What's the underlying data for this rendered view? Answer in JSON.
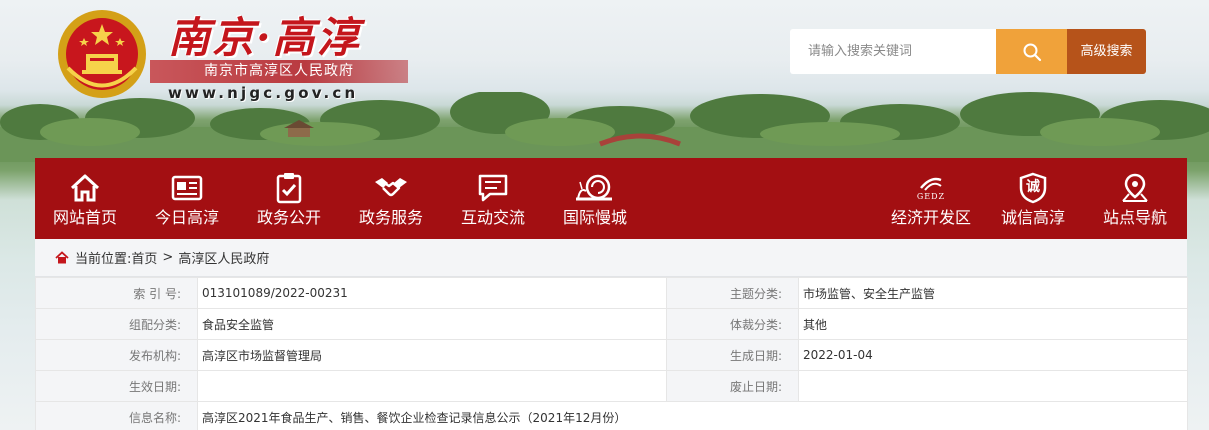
{
  "header": {
    "site_title": "南京·高淳",
    "site_subtitle": "南京市高淳区人民政府",
    "site_url": "www.njgc.gov.cn"
  },
  "search": {
    "placeholder": "请输入搜索关键词",
    "advanced_label": "高级搜索"
  },
  "nav": {
    "items": [
      {
        "label": "网站首页",
        "icon": "home-icon"
      },
      {
        "label": "今日高淳",
        "icon": "newspaper-icon"
      },
      {
        "label": "政务公开",
        "icon": "clipboard-check-icon"
      },
      {
        "label": "政务服务",
        "icon": "handshake-icon"
      },
      {
        "label": "互动交流",
        "icon": "chat-icon"
      },
      {
        "label": "国际慢城",
        "icon": "snail-icon"
      },
      {
        "label": "经济开发区",
        "icon": "gedz-logo-icon",
        "badge": "GEDZ"
      },
      {
        "label": "诚信高淳",
        "icon": "integrity-badge-icon",
        "badge": "诚"
      },
      {
        "label": "站点导航",
        "icon": "location-pin-icon"
      }
    ]
  },
  "breadcrumb": {
    "prefix": "当前位置:",
    "items": [
      "首页",
      "高淳区人民政府"
    ],
    "separator": ">"
  },
  "info_table": {
    "index_label": "索 引 号:",
    "index_value": "013101089/2022-00231",
    "topic_label": "主题分类:",
    "topic_value": "市场监管、安全生产监管",
    "category_label": "组配分类:",
    "category_value": "食品安全监管",
    "genre_label": "体裁分类:",
    "genre_value": "其他",
    "publisher_label": "发布机构:",
    "publisher_value": "高淳区市场监督管理局",
    "date_label": "生成日期:",
    "date_value": "2022-01-04",
    "effective_label": "生效日期:",
    "effective_value": "",
    "abolish_label": "废止日期:",
    "abolish_value": "",
    "name_label": "信息名称:",
    "name_value": "高淳区2021年食品生产、销售、餐饮企业检查记录信息公示（2021年12月份）"
  },
  "colors": {
    "nav_red": "#a30f12",
    "title_red": "#c4161c",
    "search_orange": "#f0a23a",
    "advanced_brown": "#b6531a"
  }
}
